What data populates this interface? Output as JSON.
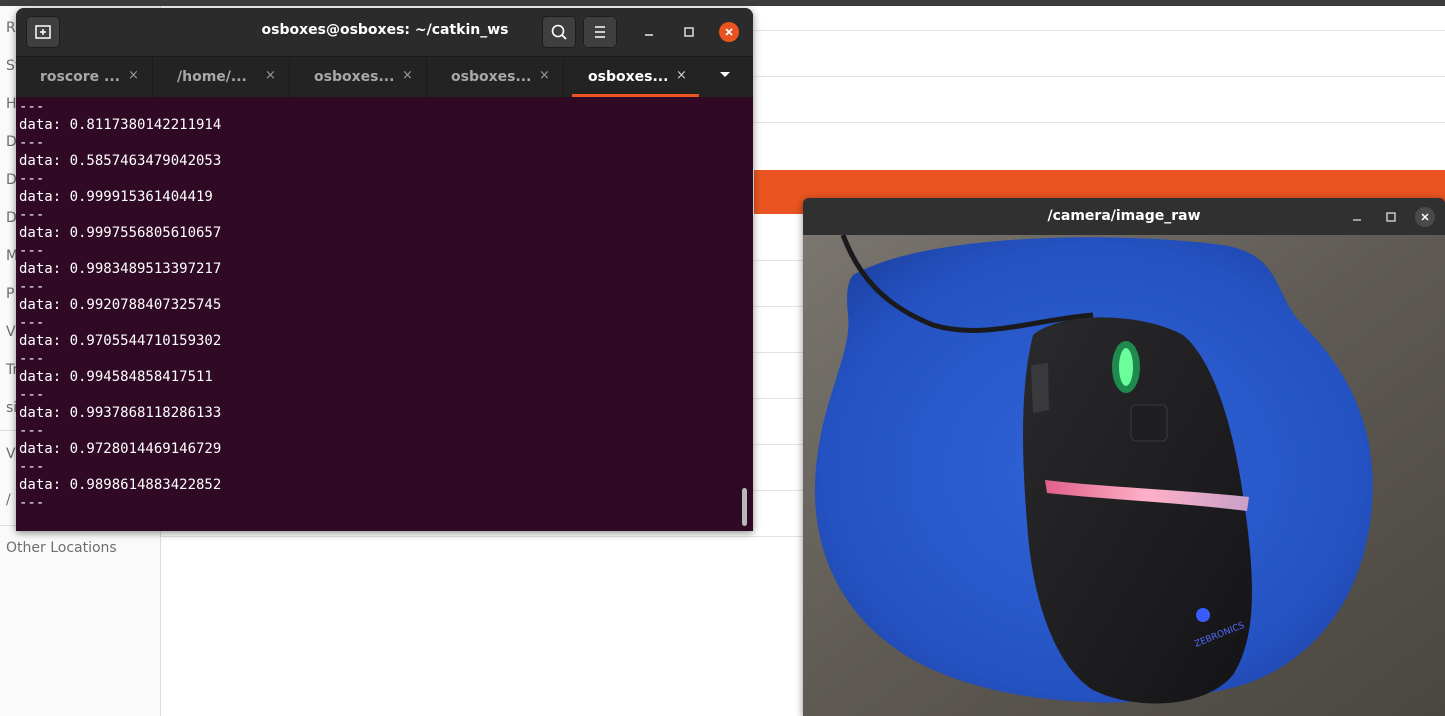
{
  "file_manager": {
    "sidebar_items": [
      "Re",
      "St",
      "H",
      "D",
      "D",
      "D",
      "M",
      "P",
      "V",
      "Tr",
      "si",
      "V",
      "/"
    ],
    "other_locations": "Other Locations"
  },
  "terminal": {
    "title": "osboxes@osboxes: ~/catkin_ws",
    "tabs": [
      {
        "label": "roscore ..."
      },
      {
        "label": "/home/..."
      },
      {
        "label": "osboxes..."
      },
      {
        "label": "osboxes..."
      },
      {
        "label": "osboxes..."
      }
    ],
    "tab_close_glyph": "×",
    "lines": [
      "---",
      "data: 0.8117380142211914",
      "---",
      "data: 0.5857463479042053",
      "---",
      "data: 0.999915361404419",
      "---",
      "data: 0.9997556805610657",
      "---",
      "data: 0.9983489513397217",
      "---",
      "data: 0.9920788407325745",
      "---",
      "data: 0.9705544710159302",
      "---",
      "data: 0.994584858417511",
      "---",
      "data: 0.9937868118286133",
      "---",
      "data: 0.9728014469146729",
      "---",
      "data: 0.9898614883422852",
      "---"
    ],
    "accent_color": "#e95420",
    "background_color": "#300a24"
  },
  "camera_window": {
    "title": "/camera/image_raw",
    "image_subject": "computer mouse on blue mouse pad",
    "mouse_logo_text": "ZEBRONICS"
  }
}
